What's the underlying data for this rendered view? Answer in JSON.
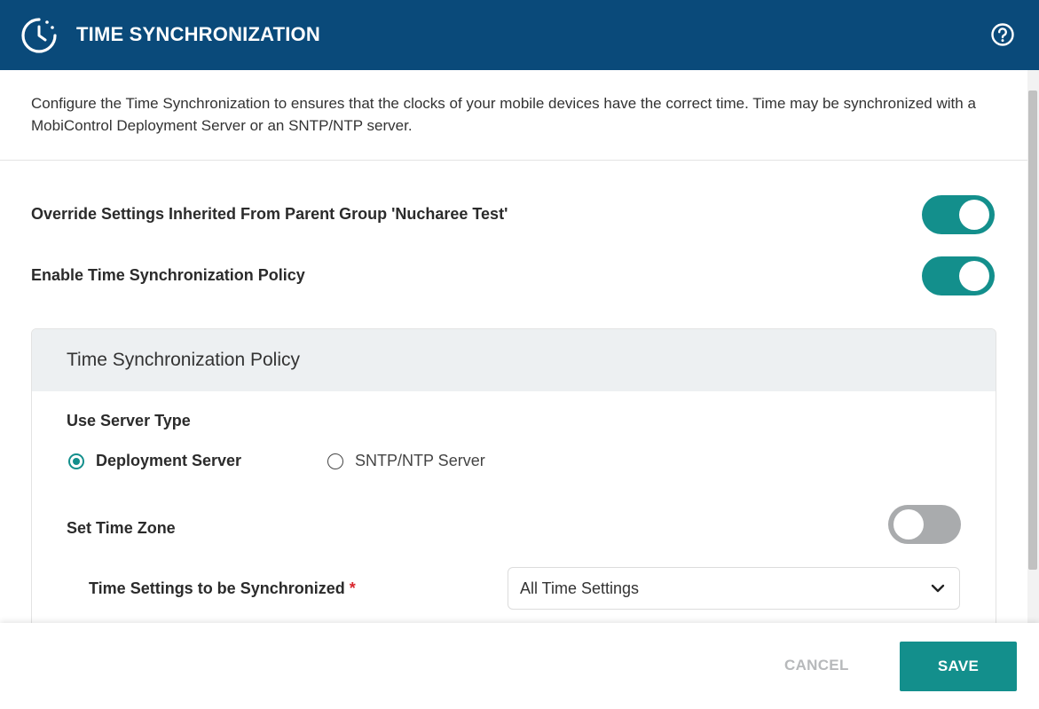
{
  "header": {
    "title": "TIME SYNCHRONIZATION",
    "icon": "clock-sync-icon",
    "help_icon": "help-circle-icon",
    "background_color": "#0a4a7a"
  },
  "description": "Configure the Time Synchronization to ensures that the clocks of your mobile devices have the correct time. Time may be synchronized with a MobiControl Deployment Server or an SNTP/NTP server.",
  "settings": {
    "override_label": "Override Settings Inherited From Parent Group 'Nucharee Test'",
    "override_enabled": true,
    "enable_policy_label": "Enable Time Synchronization Policy",
    "enable_policy_enabled": true
  },
  "policy": {
    "title": "Time Synchronization Policy",
    "server_type_label": "Use Server Type",
    "server_options": [
      {
        "label": "Deployment Server",
        "selected": true
      },
      {
        "label": "SNTP/NTP Server",
        "selected": false
      }
    ],
    "time_zone_label": "Set Time Zone",
    "time_zone_enabled": false,
    "time_settings_label": "Time Settings to be Synchronized",
    "required_marker": "*",
    "time_settings_value": "All Time Settings"
  },
  "footer": {
    "cancel_label": "CANCEL",
    "save_label": "SAVE"
  },
  "colors": {
    "accent": "#138f8c",
    "toggle_off": "#a9abad",
    "required": "#d9262d"
  }
}
